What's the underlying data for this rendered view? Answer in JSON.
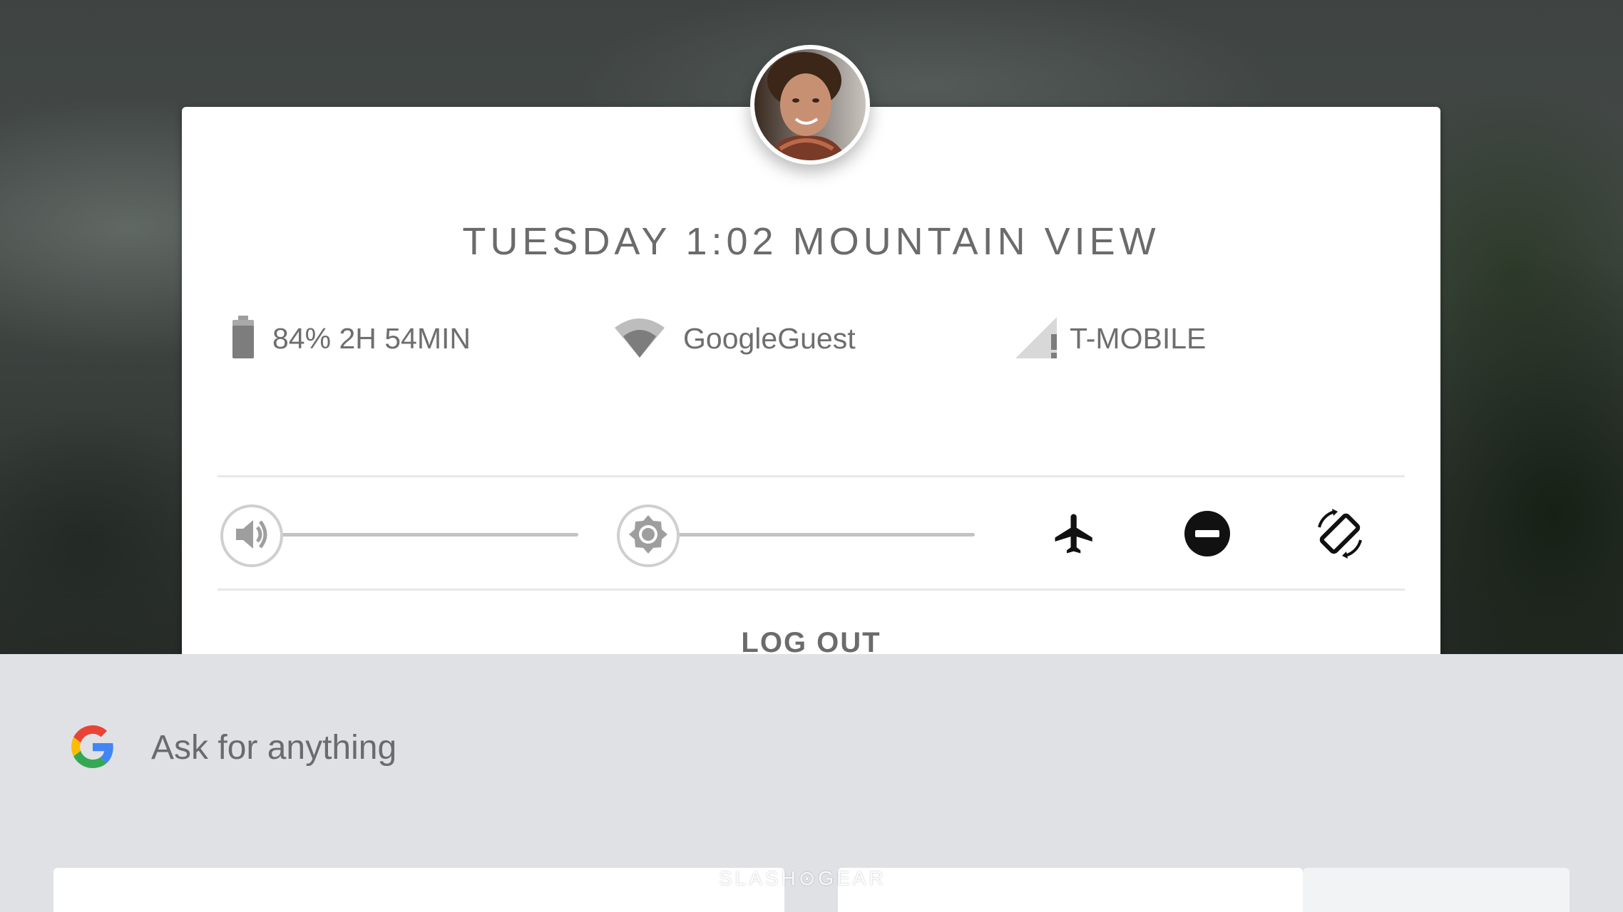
{
  "status_bar": {
    "clock_text": "TUESDAY 1:02 MOUNTAIN VIEW",
    "battery_text": "84% 2H 54MIN",
    "wifi_name": "GoogleGuest",
    "carrier": "T-MOBILE"
  },
  "icons": {
    "battery": "battery-icon",
    "wifi": "wifi-icon",
    "signal": "cell-signal-warning-icon",
    "volume": "volume-icon",
    "brightness": "brightness-icon",
    "airplane": "airplane-mode-icon",
    "dnd": "do-not-disturb-icon",
    "rotate": "auto-rotate-icon",
    "google": "google-g-icon"
  },
  "sliders": {
    "volume_level": 0,
    "brightness_level": 0
  },
  "actions": {
    "logout_label": "LOG OUT"
  },
  "assistant": {
    "prompt": "Ask for anything"
  },
  "watermark": "SLASH⊙GEAR",
  "colors": {
    "card_bg": "#ffffff",
    "text_gray": "#6b6b6b",
    "panel_bg": "#dfe1e5",
    "google_blue": "#4285F4",
    "google_red": "#EA4335",
    "google_yellow": "#FBBC05",
    "google_green": "#34A853"
  }
}
